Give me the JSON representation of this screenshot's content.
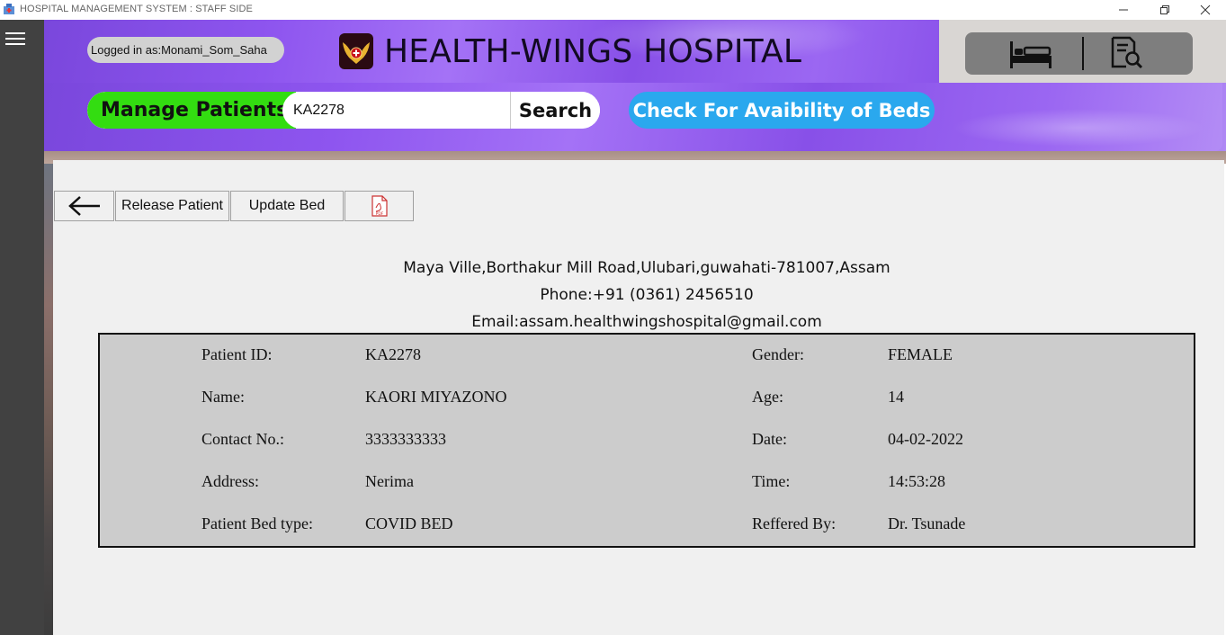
{
  "window": {
    "title": "HOSPITAL MANAGEMENT SYSTEM : STAFF SIDE",
    "minimize_symbol": "—",
    "maximize_symbol": "❐",
    "close_symbol": "✕"
  },
  "header": {
    "logged_in_label": "Logged in as:",
    "logged_in_user": "Monami_Som_Saha",
    "hospital_name": "HEALTH-WINGS HOSPITAL",
    "manage_patients_label": "Manage Patients",
    "search_value": "KA2278",
    "search_button": "Search",
    "beds_button": "Check For Avaibility of Beds",
    "icons": [
      "bed-icon",
      "report-search-icon"
    ]
  },
  "toolbar": {
    "back_symbol": "←",
    "release_label": "Release Patient",
    "update_label": "Update Bed",
    "pdf_icon": "pdf-icon"
  },
  "hospital_info": {
    "address": "Maya Ville,Borthakur Mill Road,Ulubari,guwahati-781007,Assam",
    "phone": "Phone:+91 (0361) 2456510",
    "email": "Email:assam.healthwingshospital@gmail.com"
  },
  "patient": {
    "labels": {
      "id": "Patient ID:",
      "name": "Name:",
      "contact": "Contact No.:",
      "address": "Address:",
      "bed_type": "Patient Bed type:",
      "gender": "Gender:",
      "age": "Age:",
      "date": "Date:",
      "time": "Time:",
      "referred_by": "Reffered By:"
    },
    "values": {
      "id": "KA2278",
      "name": "KAORI MIYAZONO",
      "contact": "3333333333",
      "address": "Nerima",
      "bed_type": "COVID BED",
      "gender": "FEMALE",
      "age": "14",
      "date": "04-02-2022",
      "time": "14:53:28",
      "referred_by": "Dr. Tsunade"
    }
  },
  "colors": {
    "sidebar": "#414141",
    "manage_green": "#33dd11",
    "beds_blue": "#2aa8ee",
    "banner_purple": "#8e55ef",
    "patient_box": "#cccccc"
  }
}
